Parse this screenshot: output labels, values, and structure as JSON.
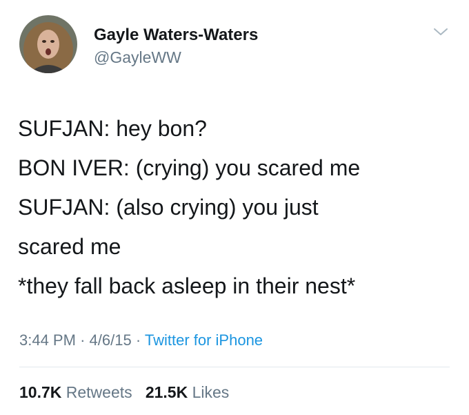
{
  "user": {
    "display_name": "Gayle Waters-Waters",
    "handle": "@GayleWW"
  },
  "tweet": {
    "lines": [
      "SUFJAN: hey bon?",
      "BON IVER: (crying) you scared me",
      "SUFJAN: (also crying) you just",
      "scared me",
      "*they fall back asleep in their nest*"
    ],
    "time": "3:44 PM",
    "sep1": "·",
    "date": "4/6/15",
    "sep2": "·",
    "source": "Twitter for iPhone"
  },
  "stats": {
    "retweets_count": "10.7K",
    "retweets_label": "Retweets",
    "likes_count": "21.5K",
    "likes_label": "Likes"
  },
  "icons": {
    "menu": "chevron-down-icon",
    "avatar": "avatar"
  },
  "colors": {
    "text": "#14171a",
    "secondary": "#657786",
    "link": "#1b95e0",
    "divider": "#e1e8ed"
  }
}
